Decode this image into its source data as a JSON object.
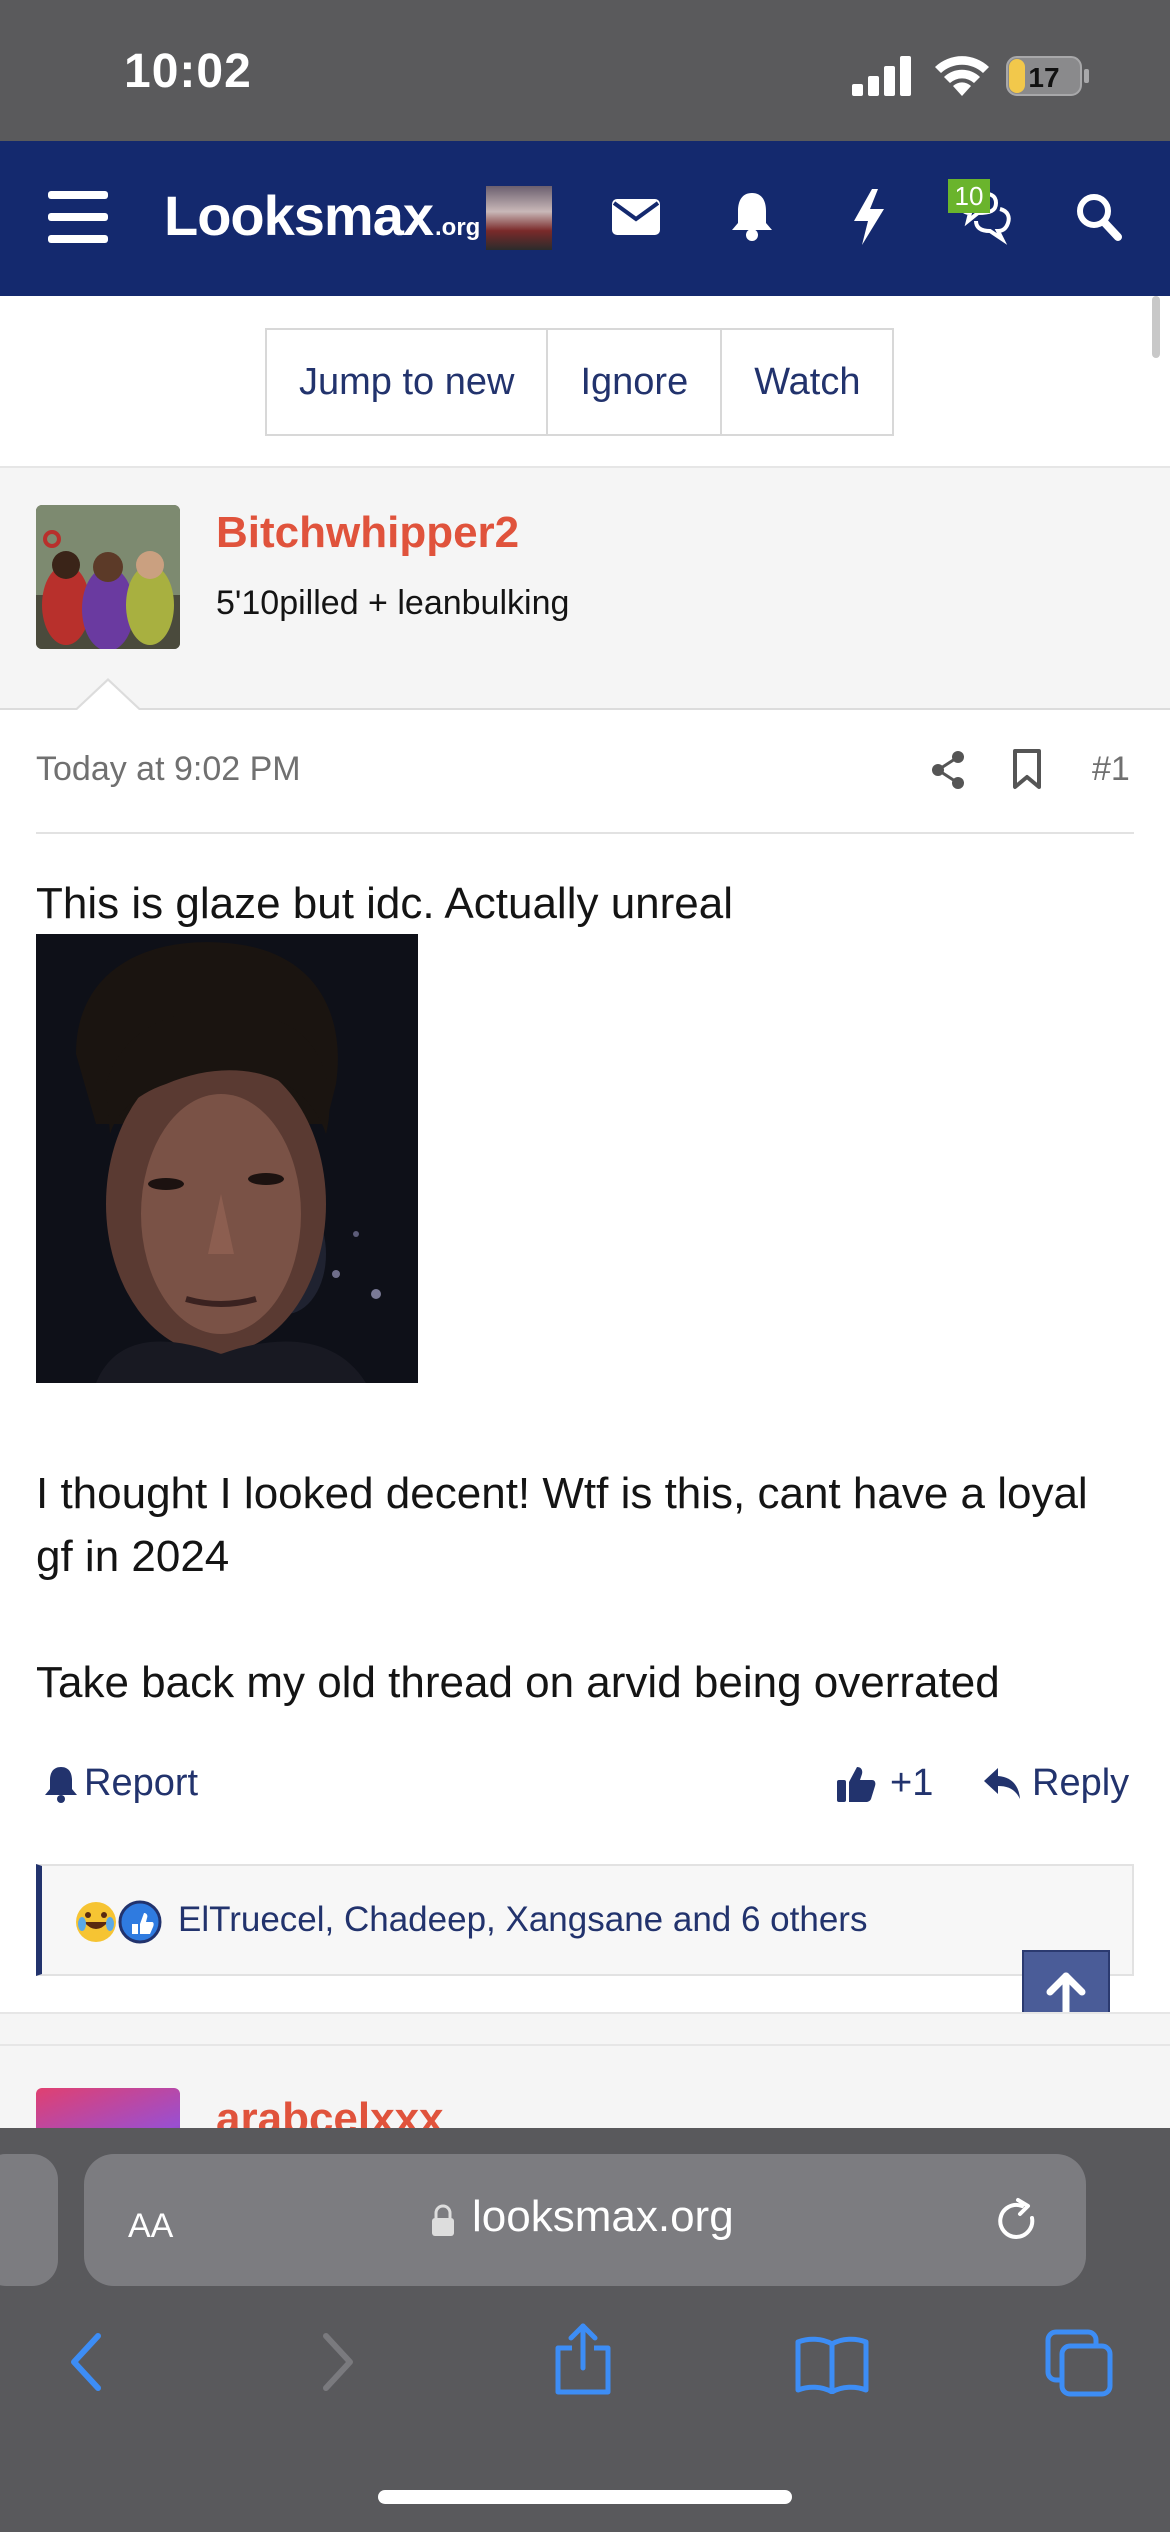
{
  "status_bar": {
    "time": "10:02",
    "battery": "17"
  },
  "nav": {
    "logo_main": "Looksmax",
    "logo_suffix": ".org",
    "conversations_count": "10"
  },
  "thread_buttons": [
    "Jump to new",
    "Ignore",
    "Watch"
  ],
  "post": {
    "username": "Bitchwhipper2",
    "user_title": "5'10pilled + leanbulking",
    "date": "Today at 9:02 PM",
    "number": "#1",
    "line1": "This is glaze but idc. Actually unreal",
    "line2a": "I thought I looked decent! Wtf is this, cant have a loyal",
    "line2b": "gf in 2024",
    "line3": "Take back my old thread on arvid being overrated",
    "report_label": "Report",
    "like_label": "+1",
    "reply_label": "Reply",
    "reactions_text": "ElTruecel, Chadeep, Xangsane and 6 others"
  },
  "next_post": {
    "username": "arabcelxxx"
  },
  "browser": {
    "aa_label": "AA",
    "url": "looksmax.org"
  },
  "colors": {
    "nav_bg": "#14296e",
    "link": "#22336d",
    "username": "#e0533c",
    "badge": "#6ab42c"
  }
}
